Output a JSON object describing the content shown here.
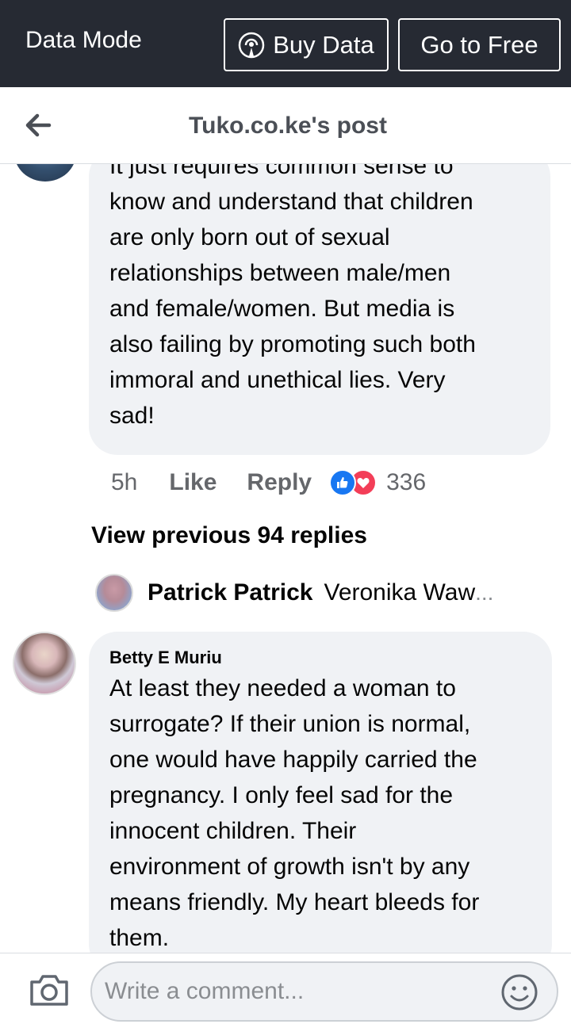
{
  "top_bar": {
    "mode_label": "Data Mode",
    "buy_data_label": "Buy Data",
    "go_free_label": "Go to Free"
  },
  "header": {
    "title": "Tuko.co.ke's post"
  },
  "comment_1": {
    "lines": [
      "It just requires common sense to",
      "know and understand that children",
      "are only born out of sexual",
      "relationships between male/men",
      "and female/women. But media is",
      "also failing by promoting such both",
      "immoral and unethical lies. Very",
      "sad!"
    ],
    "time": "5h",
    "like_label": "Like",
    "reply_label": "Reply",
    "reaction_count": "336"
  },
  "view_previous": "View previous 94 replies",
  "reply_preview": {
    "name": "Patrick Patrick",
    "snippet": "Veronika Waw",
    "ellipsis": "..."
  },
  "comment_2": {
    "author": "Betty E Muriu",
    "lines": [
      "At least they needed a woman to",
      "surrogate? If their union is normal,",
      "one would have happily carried the",
      "pregnancy. I only feel sad for the",
      "innocent children. Their",
      "environment of growth isn't by any",
      "means friendly. My heart bleeds for",
      "them."
    ]
  },
  "composer": {
    "placeholder": "Write a comment..."
  },
  "colors": {
    "top_bar": "#262a33",
    "bubble": "#f0f2f5",
    "like_blue": "#1877f2",
    "love_red": "#f33e58"
  },
  "icons": [
    "broadcast-icon",
    "back-arrow-icon",
    "like-reaction-icon",
    "love-reaction-icon",
    "camera-icon",
    "emoji-icon"
  ]
}
